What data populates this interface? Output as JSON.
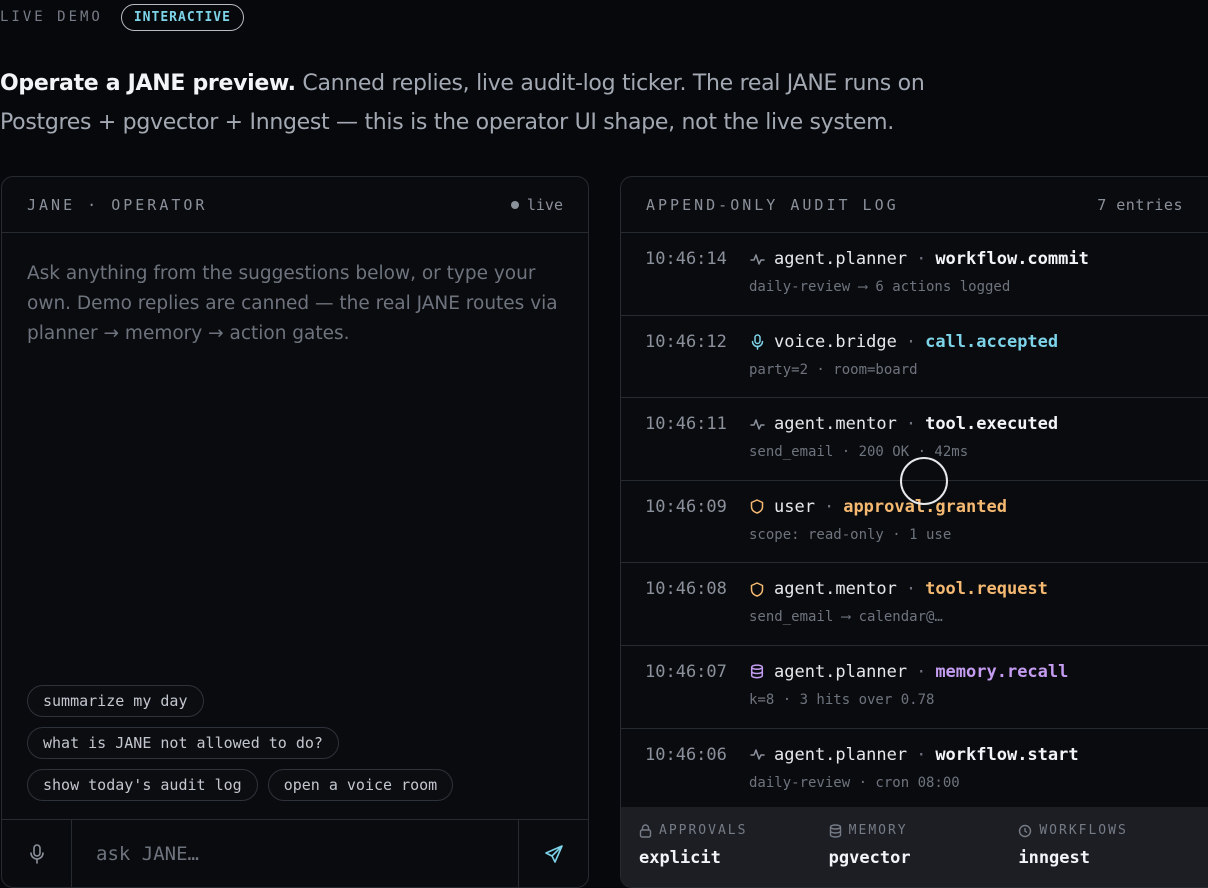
{
  "header": {
    "eyebrow": "LIVE DEMO",
    "badge": "INTERACTIVE",
    "intro_bold": "Operate a JANE preview.",
    "intro_rest": " Canned replies, live audit-log ticker. The real JANE runs on Postgres + pgvector + Inngest — this is the operator UI shape, not the live system."
  },
  "operator": {
    "title": "JANE · OPERATOR",
    "status": "live",
    "prompt": "Ask anything from the suggestions below, or type your own. Demo replies are canned — the real JANE routes via planner → memory → action gates.",
    "suggestions": [
      [
        "summarize my day"
      ],
      [
        "what is JANE not allowed to do?"
      ],
      [
        "show today's audit log",
        "open a voice room"
      ]
    ],
    "input_placeholder": "ask JANE…"
  },
  "audit": {
    "title": "APPEND-ONLY AUDIT LOG",
    "count": "7 entries",
    "entries": [
      {
        "time": "10:46:14",
        "icon": "activity-icon",
        "source": "agent.planner",
        "event": "workflow.commit",
        "color": "#f2f4f7",
        "detail": "daily-review ⟶ 6 actions logged"
      },
      {
        "time": "10:46:12",
        "icon": "mic-icon",
        "source": "voice.bridge",
        "event": "call.accepted",
        "color": "#7dd3e8",
        "detail": "party=2 · room=board"
      },
      {
        "time": "10:46:11",
        "icon": "activity-icon",
        "source": "agent.mentor",
        "event": "tool.executed",
        "color": "#f2f4f7",
        "detail": "send_email · 200 OK · 42ms"
      },
      {
        "time": "10:46:09",
        "icon": "shield-icon",
        "source": "user",
        "event": "approval.granted",
        "color": "#f5b971",
        "detail": "scope: read-only · 1 use"
      },
      {
        "time": "10:46:08",
        "icon": "shield-icon",
        "source": "agent.mentor",
        "event": "tool.request",
        "color": "#f5b971",
        "detail": "send_email ⟶ calendar@…"
      },
      {
        "time": "10:46:07",
        "icon": "database-icon",
        "source": "agent.planner",
        "event": "memory.recall",
        "color": "#c49cf0",
        "detail": "k=8 · 3 hits over 0.78"
      },
      {
        "time": "10:46:06",
        "icon": "activity-icon",
        "source": "agent.planner",
        "event": "workflow.start",
        "color": "#f2f4f7",
        "detail": "daily-review · cron 08:00"
      }
    ],
    "footer": [
      {
        "icon": "lock-icon",
        "label": "APPROVALS",
        "value": "explicit"
      },
      {
        "icon": "database-icon",
        "label": "MEMORY",
        "value": "pgvector"
      },
      {
        "icon": "clock-icon",
        "label": "WORKFLOWS",
        "value": "inngest"
      }
    ]
  },
  "colors": {
    "accent_cyan": "#7dd3e8",
    "accent_amber": "#f5b971",
    "accent_purple": "#c49cf0"
  }
}
